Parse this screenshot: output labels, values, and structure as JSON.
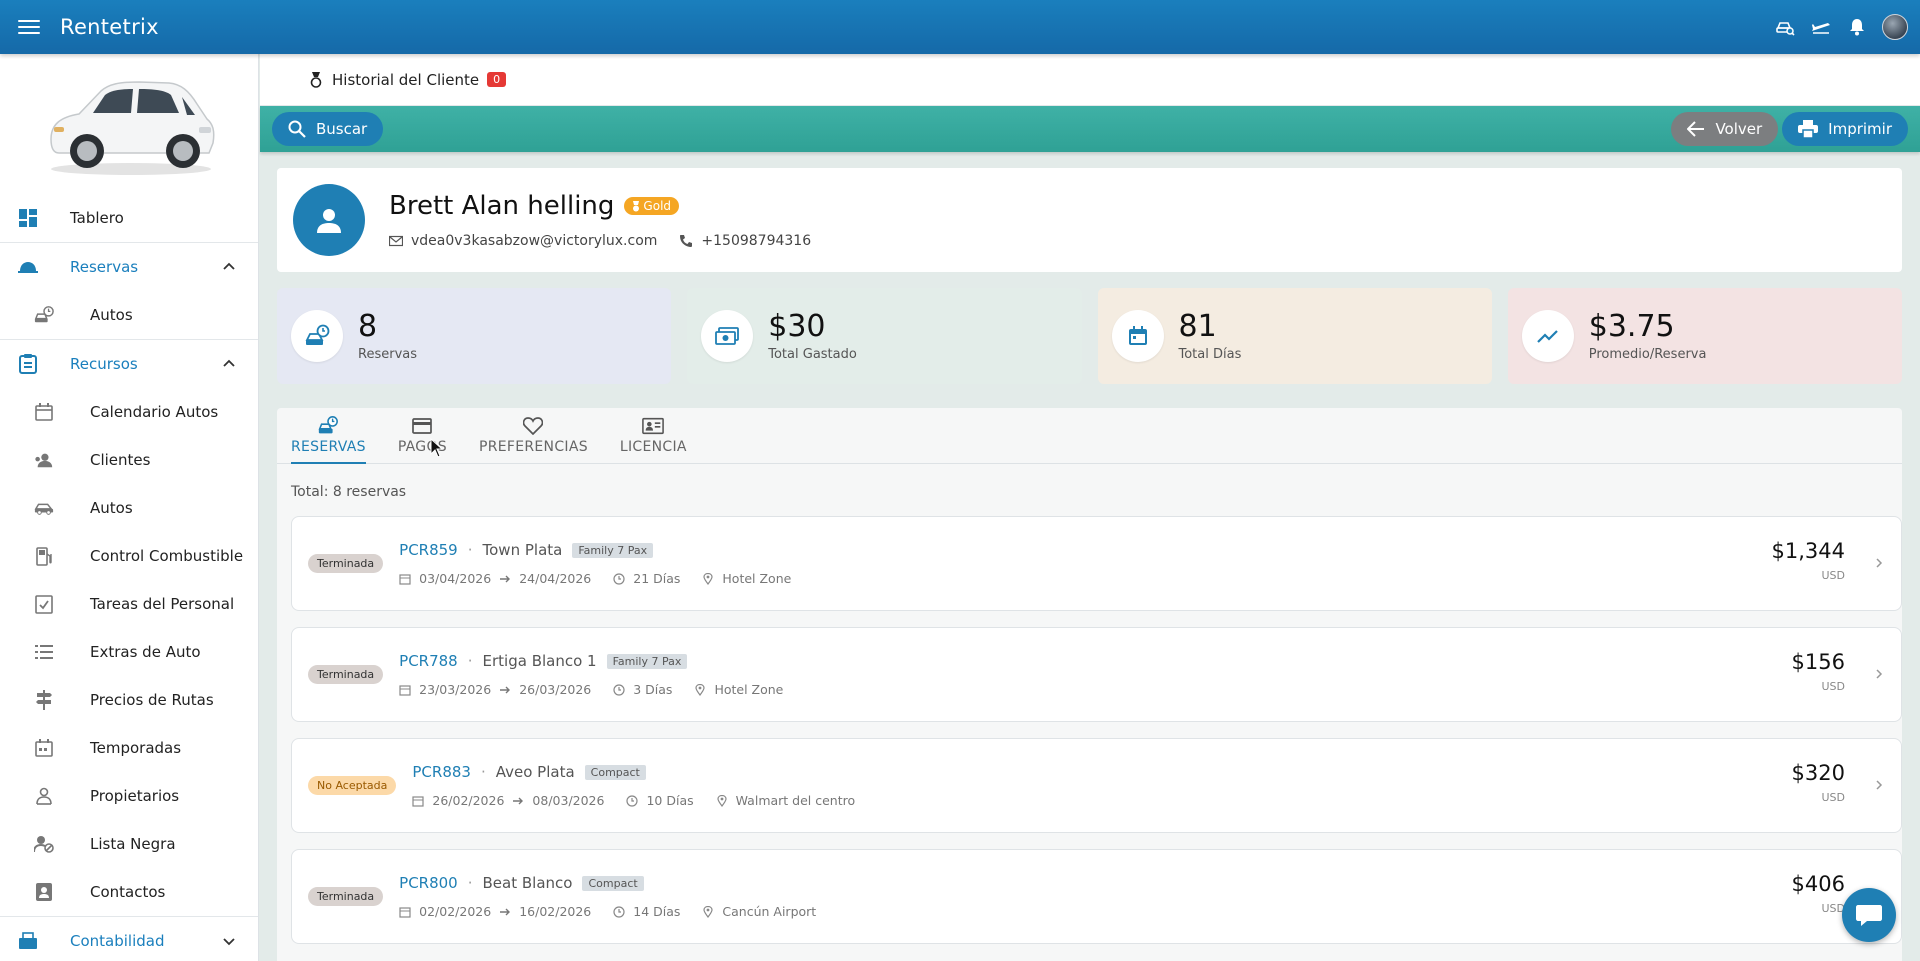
{
  "app": {
    "title": "Rentetrix"
  },
  "topbar": {
    "icons": [
      "car-search-icon",
      "plane-icon",
      "bell-icon",
      "user-avatar"
    ]
  },
  "sidebar": {
    "items": [
      {
        "label": "Tablero",
        "icon": "dashboard-icon"
      },
      {
        "label": "Reservas",
        "icon": "bell-service-icon",
        "group": true,
        "expanded": true
      },
      {
        "label": "Autos",
        "icon": "car-clock-icon"
      },
      {
        "label": "Recursos",
        "icon": "clipboard-icon",
        "group": true,
        "expanded": true
      },
      {
        "label": "Calendario Autos",
        "icon": "calendar-icon"
      },
      {
        "label": "Clientes",
        "icon": "users-icon"
      },
      {
        "label": "Autos",
        "icon": "car-icon"
      },
      {
        "label": "Control Combustible",
        "icon": "fuel-icon"
      },
      {
        "label": "Tareas del Personal",
        "icon": "tasks-icon"
      },
      {
        "label": "Extras de Auto",
        "icon": "list-icon"
      },
      {
        "label": "Precios de Rutas",
        "icon": "signpost-icon"
      },
      {
        "label": "Temporadas",
        "icon": "calendar-grid-icon"
      },
      {
        "label": "Propietarios",
        "icon": "owners-icon"
      },
      {
        "label": "Lista Negra",
        "icon": "user-block-icon"
      },
      {
        "label": "Contactos",
        "icon": "contacts-icon"
      },
      {
        "label": "Contabilidad",
        "icon": "accounting-icon",
        "group": true,
        "expanded": false
      }
    ]
  },
  "breadcrumb": {
    "label": "Historial del Cliente",
    "count": "0"
  },
  "toolbar": {
    "search": "Buscar",
    "back": "Volver",
    "print": "Imprimir"
  },
  "customer": {
    "name": "Brett Alan helling",
    "tier": "Gold",
    "email": "vdea0v3kasabzow@victorylux.com",
    "phone": "+15098794316"
  },
  "stats": [
    {
      "value": "8",
      "label": "Reservas"
    },
    {
      "value": "$30",
      "label": "Total Gastado"
    },
    {
      "value": "81",
      "label": "Total Días"
    },
    {
      "value": "$3.75",
      "label": "Promedio/Reserva"
    }
  ],
  "tabs": [
    {
      "label": "RESERVAS",
      "active": true
    },
    {
      "label": "PAGOS",
      "active": false
    },
    {
      "label": "PREFERENCIAS",
      "active": false
    },
    {
      "label": "LICENCIA",
      "active": false
    }
  ],
  "total_text": "Total: 8 reservas",
  "reservations": [
    {
      "status": "Terminada",
      "code": "PCR859",
      "car": "Town Plata",
      "category": "Family 7 Pax",
      "from": "03/04/2026",
      "to": "24/04/2026",
      "days": "21 Días",
      "location": "Hotel Zone",
      "amount": "$1,344",
      "currency": "USD"
    },
    {
      "status": "Terminada",
      "code": "PCR788",
      "car": "Ertiga Blanco 1",
      "category": "Family 7 Pax",
      "from": "23/03/2026",
      "to": "26/03/2026",
      "days": "3 Días",
      "location": "Hotel Zone",
      "amount": "$156",
      "currency": "USD"
    },
    {
      "status": "No Aceptada",
      "code": "PCR883",
      "car": "Aveo Plata",
      "category": "Compact",
      "from": "26/02/2026",
      "to": "08/03/2026",
      "days": "10 Días",
      "location": "Walmart del centro",
      "amount": "$320",
      "currency": "USD"
    },
    {
      "status": "Terminada",
      "code": "PCR800",
      "car": "Beat Blanco",
      "category": "Compact",
      "from": "02/02/2026",
      "to": "16/02/2026",
      "days": "14 Días",
      "location": "Cancún Airport",
      "amount": "$406",
      "currency": "USD"
    }
  ]
}
